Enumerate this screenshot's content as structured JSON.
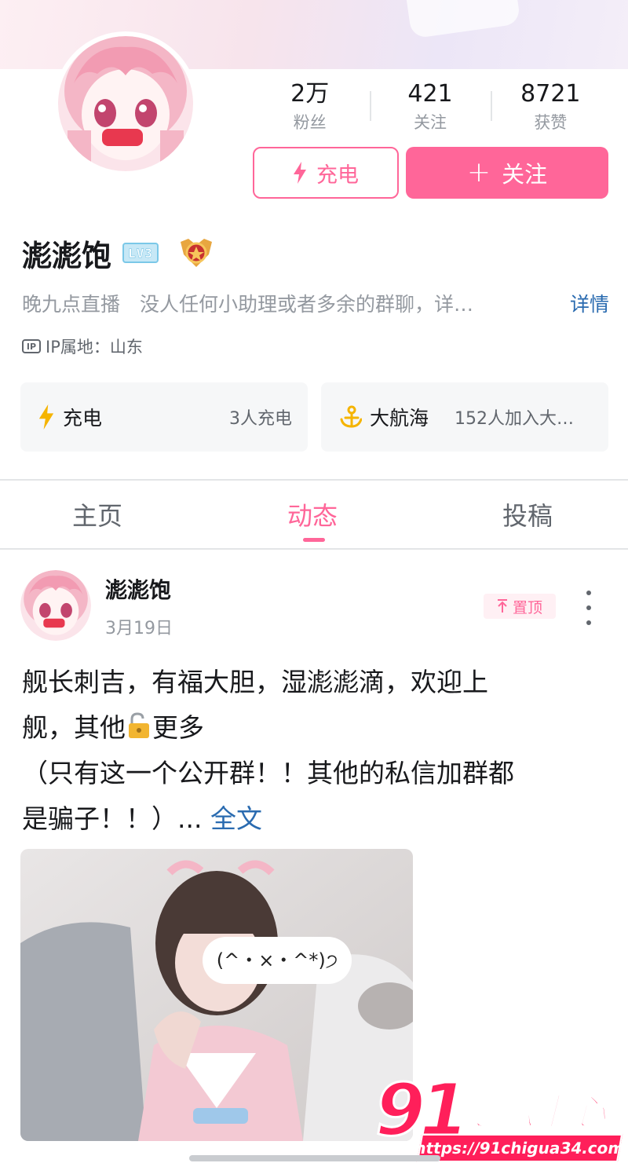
{
  "profile": {
    "name": "滮滮饱",
    "level_badge": "LV3",
    "stats": [
      {
        "value": "2万",
        "label": "粉丝"
      },
      {
        "value": "421",
        "label": "关注"
      },
      {
        "value": "8721",
        "label": "获赞"
      }
    ],
    "charge_button": "充电",
    "follow_button": "关注",
    "follow_plus": "+",
    "signature": "晚九点直播　没人任何小助理或者多余的群聊，详…",
    "detail_link": "详情",
    "ip_label": "IP属地：山东",
    "ip_icon_text": "IP"
  },
  "cards": [
    {
      "icon": "lightning-icon",
      "title": "充电",
      "sub": "3人充电"
    },
    {
      "icon": "anchor-icon",
      "title": "大航海",
      "sub": "152人加入大…"
    }
  ],
  "tabs": [
    {
      "label": "主页",
      "active": false
    },
    {
      "label": "动态",
      "active": true
    },
    {
      "label": "投稿",
      "active": false
    }
  ],
  "post": {
    "author": "滮滮饱",
    "date": "3月19日",
    "pin_label": "置顶",
    "text_line1": "舰长刺吉，有福大胆，湿滮滮滴，欢迎上",
    "text_line2_a": "舰，其他",
    "text_line2_b": "更多",
    "text_line3": "（只有这一个公开群！！其他的私信加群都",
    "text_line4": "是骗子！！）... ",
    "full_text_link": "全文",
    "sticker_text": "(^・×・^*)੭"
  },
  "watermark": {
    "number": "91",
    "name": "吃瓜中心",
    "url": "https://91chigua34.com"
  },
  "colors": {
    "accent": "#ff6699",
    "link": "#2a6bb0",
    "text_primary": "#18191c",
    "text_secondary": "#9499a0",
    "watermark_red": "#ff1f5a"
  }
}
